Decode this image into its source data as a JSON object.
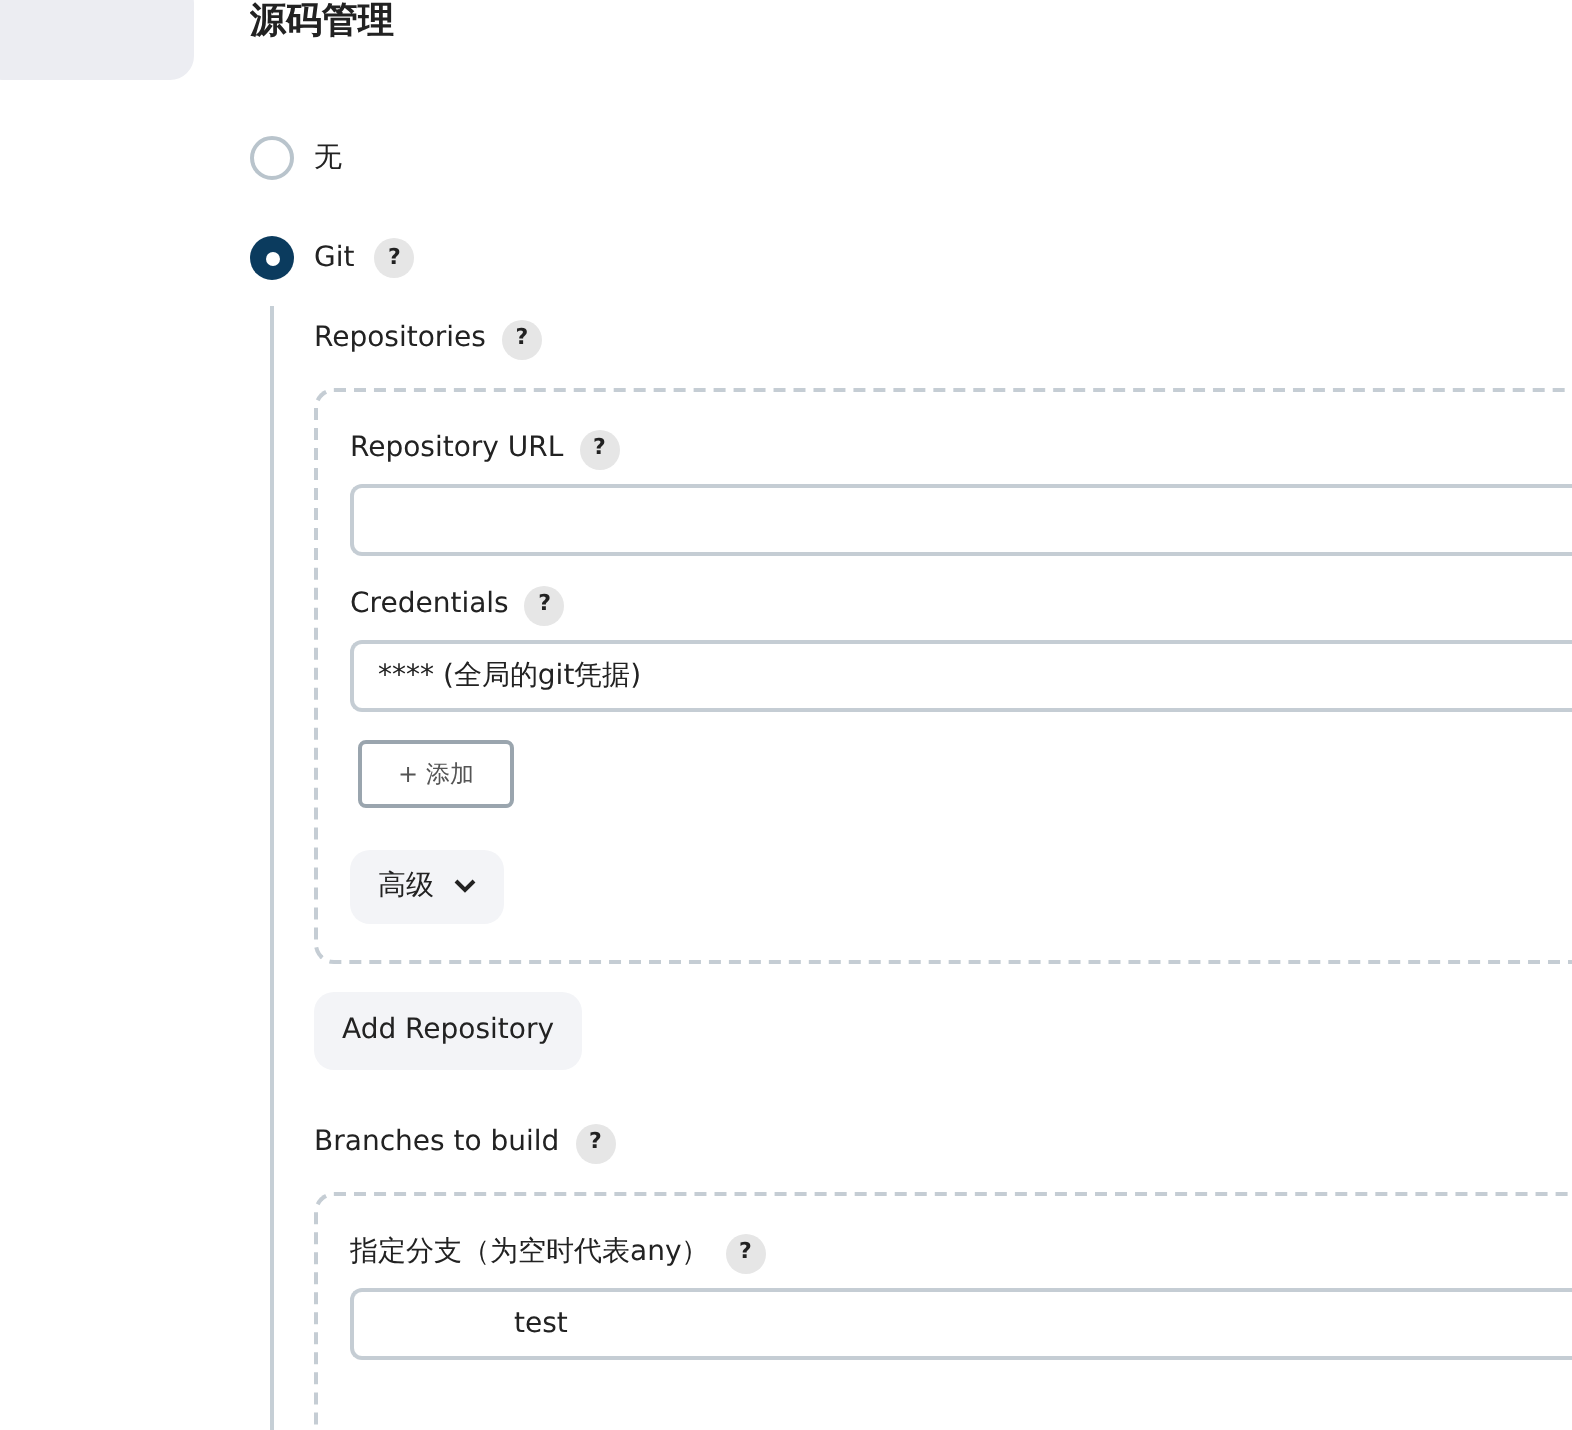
{
  "section_title": "源码管理",
  "scm_options": [
    {
      "label": "无",
      "selected": false
    },
    {
      "label": "Git",
      "selected": true,
      "help": "?"
    }
  ],
  "repositories": {
    "label": "Repositories",
    "help": "?",
    "fields": [
      {
        "label": "Repository URL",
        "help": "?"
      },
      {
        "label": "Credentials",
        "help": "?",
        "value": "**** (全局的git凭据)"
      }
    ],
    "add_button": "+ 添加",
    "advanced_button": "高级"
  },
  "add_repository_button": "Add Repository",
  "branches": {
    "label": "Branches to build",
    "help": "?",
    "fields": [
      {
        "label": "指定分支（为空时代表any）",
        "help": "?",
        "value": "test"
      }
    ]
  }
}
